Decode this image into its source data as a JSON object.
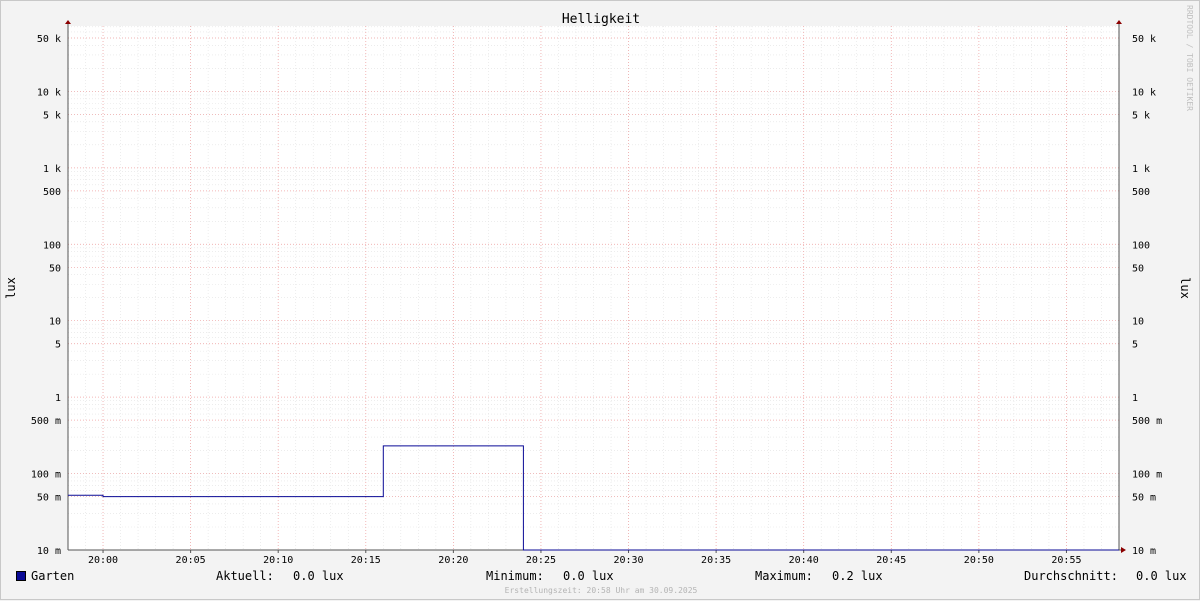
{
  "chart_data": {
    "type": "line",
    "title": "Helligkeit",
    "ylabel": "lux",
    "yscale": "log",
    "ylim": [
      10,
      70000
    ],
    "xlim": [
      "19:58",
      "20:58"
    ],
    "x_ticks": [
      "20:00",
      "20:05",
      "20:10",
      "20:15",
      "20:20",
      "20:25",
      "20:30",
      "20:35",
      "20:40",
      "20:45",
      "20:50",
      "20:55"
    ],
    "y_ticks": [
      {
        "value": 50000,
        "label": "50 k"
      },
      {
        "value": 10000,
        "label": "10 k"
      },
      {
        "value": 5000,
        "label": "5 k"
      },
      {
        "value": 1000,
        "label": "1 k"
      },
      {
        "value": 500,
        "label": "500"
      },
      {
        "value": 100,
        "label": "100"
      },
      {
        "value": 50,
        "label": "50"
      },
      {
        "value": 10,
        "label": "10"
      },
      {
        "value": 5,
        "label": "5"
      },
      {
        "value": 1,
        "label": "1"
      },
      {
        "value": 0.5,
        "label": "500 m"
      },
      {
        "value": 0.1,
        "label": "100 m"
      },
      {
        "value": 0.05,
        "label": "50 m"
      },
      {
        "value": 0.01,
        "label": "10 m"
      }
    ],
    "grid": true,
    "series": [
      {
        "name": "Garten",
        "color": "#0a0a96",
        "points": [
          [
            "19:58",
            0.052
          ],
          [
            "20:00",
            0.052
          ],
          [
            "20:00",
            0.05
          ],
          [
            "20:16",
            0.05
          ],
          [
            "20:16",
            0.23
          ],
          [
            "20:24",
            0.23
          ],
          [
            "20:24",
            0.01
          ],
          [
            "20:58",
            0.01
          ]
        ]
      }
    ]
  },
  "legend": {
    "series_name": "Garten",
    "current_label": "Aktuell:",
    "current_value": "0.0 lux",
    "min_label": "Minimum:",
    "min_value": "0.0 lux",
    "max_label": "Maximum:",
    "max_value": "0.2 lux",
    "avg_label": "Durchschnitt:",
    "avg_value": "0.0 lux"
  },
  "footer": "Erstellungszeit: 20:58 Uhr am 30.09.2025",
  "watermark": "RRDTOOL / TOBI OETIKER"
}
